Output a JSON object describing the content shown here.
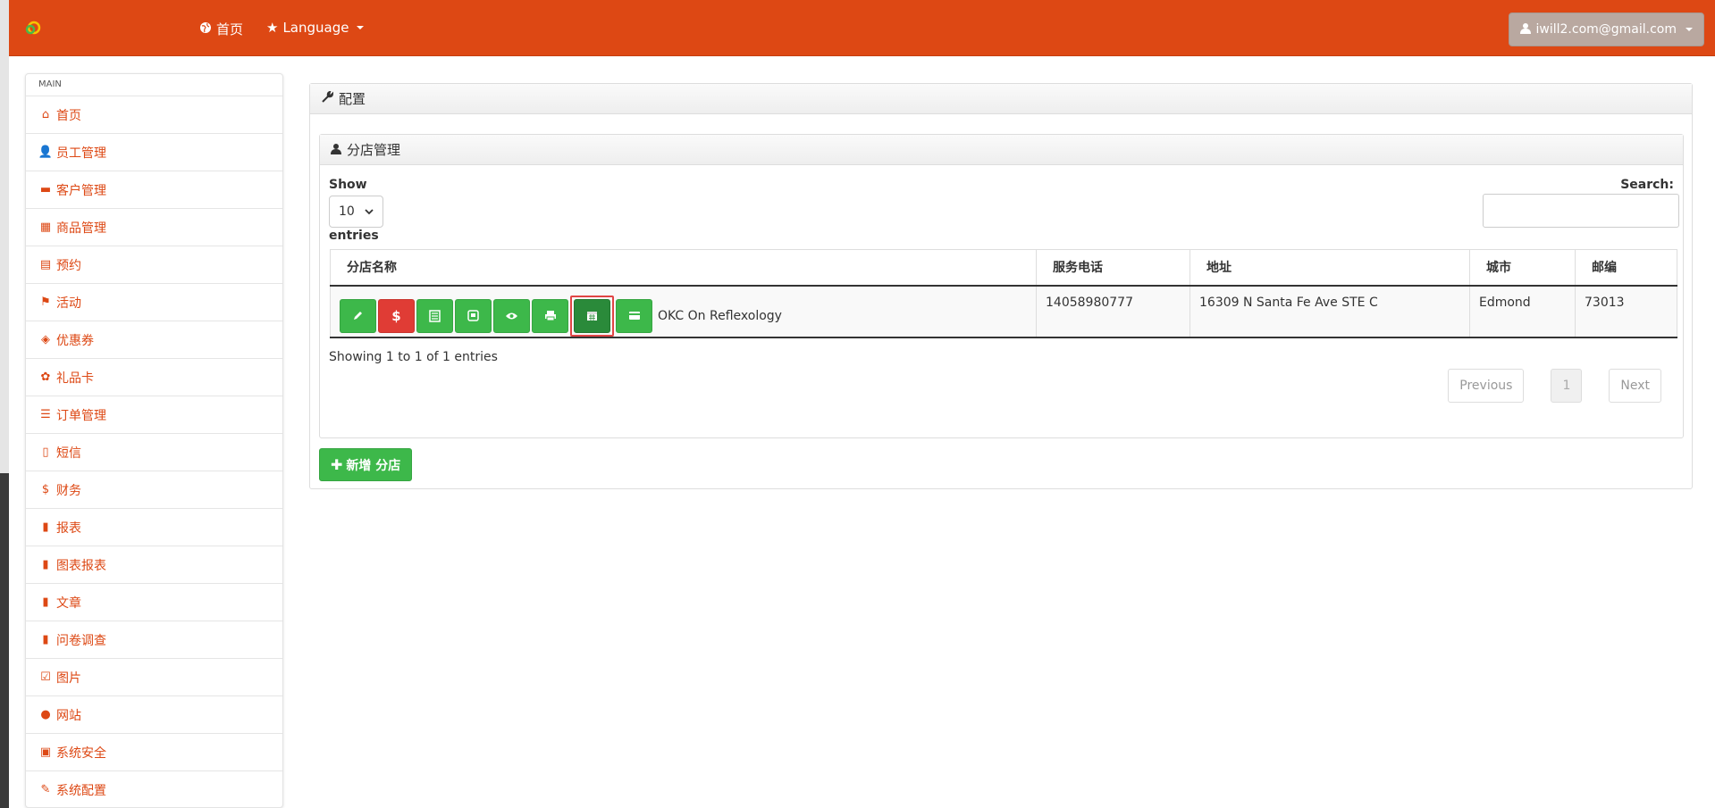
{
  "navbar": {
    "home_label": "首页",
    "language_label": "Language",
    "user_label": "iwill2.com@gmail.com"
  },
  "sidebar": {
    "header": "MAIN",
    "items": [
      {
        "label": "首页",
        "icon": "home-icon"
      },
      {
        "label": "员工管理",
        "icon": "user-icon"
      },
      {
        "label": "客户管理",
        "icon": "briefcase-icon"
      },
      {
        "label": "商品管理",
        "icon": "grid-icon"
      },
      {
        "label": "预约",
        "icon": "calendar-icon"
      },
      {
        "label": "活动",
        "icon": "flag-icon"
      },
      {
        "label": "优惠券",
        "icon": "tags-icon"
      },
      {
        "label": "礼品卡",
        "icon": "gift-icon"
      },
      {
        "label": "订单管理",
        "icon": "list-icon"
      },
      {
        "label": "短信",
        "icon": "mobile-icon"
      },
      {
        "label": "财务",
        "icon": "dollar-icon"
      },
      {
        "label": "报表",
        "icon": "bar-chart-icon"
      },
      {
        "label": "图表报表",
        "icon": "bar-chart-icon"
      },
      {
        "label": "文章",
        "icon": "file-icon"
      },
      {
        "label": "问卷调查",
        "icon": "file-icon"
      },
      {
        "label": "图片",
        "icon": "check-square-icon"
      },
      {
        "label": "网站",
        "icon": "globe-icon"
      },
      {
        "label": "系统安全",
        "icon": "lock-icon"
      },
      {
        "label": "系统配置",
        "icon": "wrench-icon"
      }
    ]
  },
  "main": {
    "title": "配置",
    "branch_panel": {
      "title": "分店管理",
      "show_label": "Show",
      "page_size": "10",
      "entries_label": "entries",
      "search_label": "Search:",
      "search_value": "",
      "columns": [
        "分店名称",
        "服务电话",
        "地址",
        "城市",
        "邮编"
      ],
      "rows": [
        {
          "name": "OKC On Reflexology",
          "phone": "14058980777",
          "address": "16309 N Santa Fe Ave STE C",
          "city": "Edmond",
          "zip": "73013"
        }
      ],
      "info": "Showing 1 to 1 of 1 entries",
      "pagination": {
        "previous": "Previous",
        "page": "1",
        "next": "Next"
      }
    },
    "add_button": "新增 分店"
  },
  "colors": {
    "brand": "#dd4814",
    "success": "#3db84a",
    "danger": "#e03c35",
    "highlight": "#e04545"
  }
}
